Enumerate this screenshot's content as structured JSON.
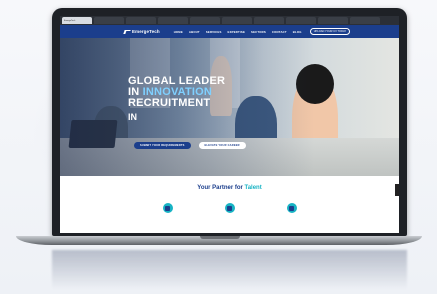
{
  "browser": {
    "tabs": [
      "EmergeTech",
      "",
      "",
      "",
      "",
      "",
      "",
      "",
      "",
      ""
    ]
  },
  "nav": {
    "logo_text": "EmergeTech",
    "menu": [
      "HOME",
      "ABOUT",
      "SERVICES",
      "EXPERTISE",
      "SECTORS",
      "CONTACT",
      "BLOG"
    ],
    "cta": "UPLOAD YOUR CV TODAY"
  },
  "hero": {
    "line1": "GLOBAL LEADER",
    "line2_prefix": "IN ",
    "line2_accent": "INNOVATION",
    "line3": "RECRUITMENT",
    "typed": "IN",
    "btn_primary": "SUBMIT YOUR REQUIREMENTS",
    "btn_secondary": "ELEVATE YOUR CAREER"
  },
  "partner": {
    "title_prefix": "Your Partner for ",
    "title_accent": "Talent"
  },
  "colors": {
    "brand": "#1b3e8c",
    "accent": "#17b3c4"
  }
}
